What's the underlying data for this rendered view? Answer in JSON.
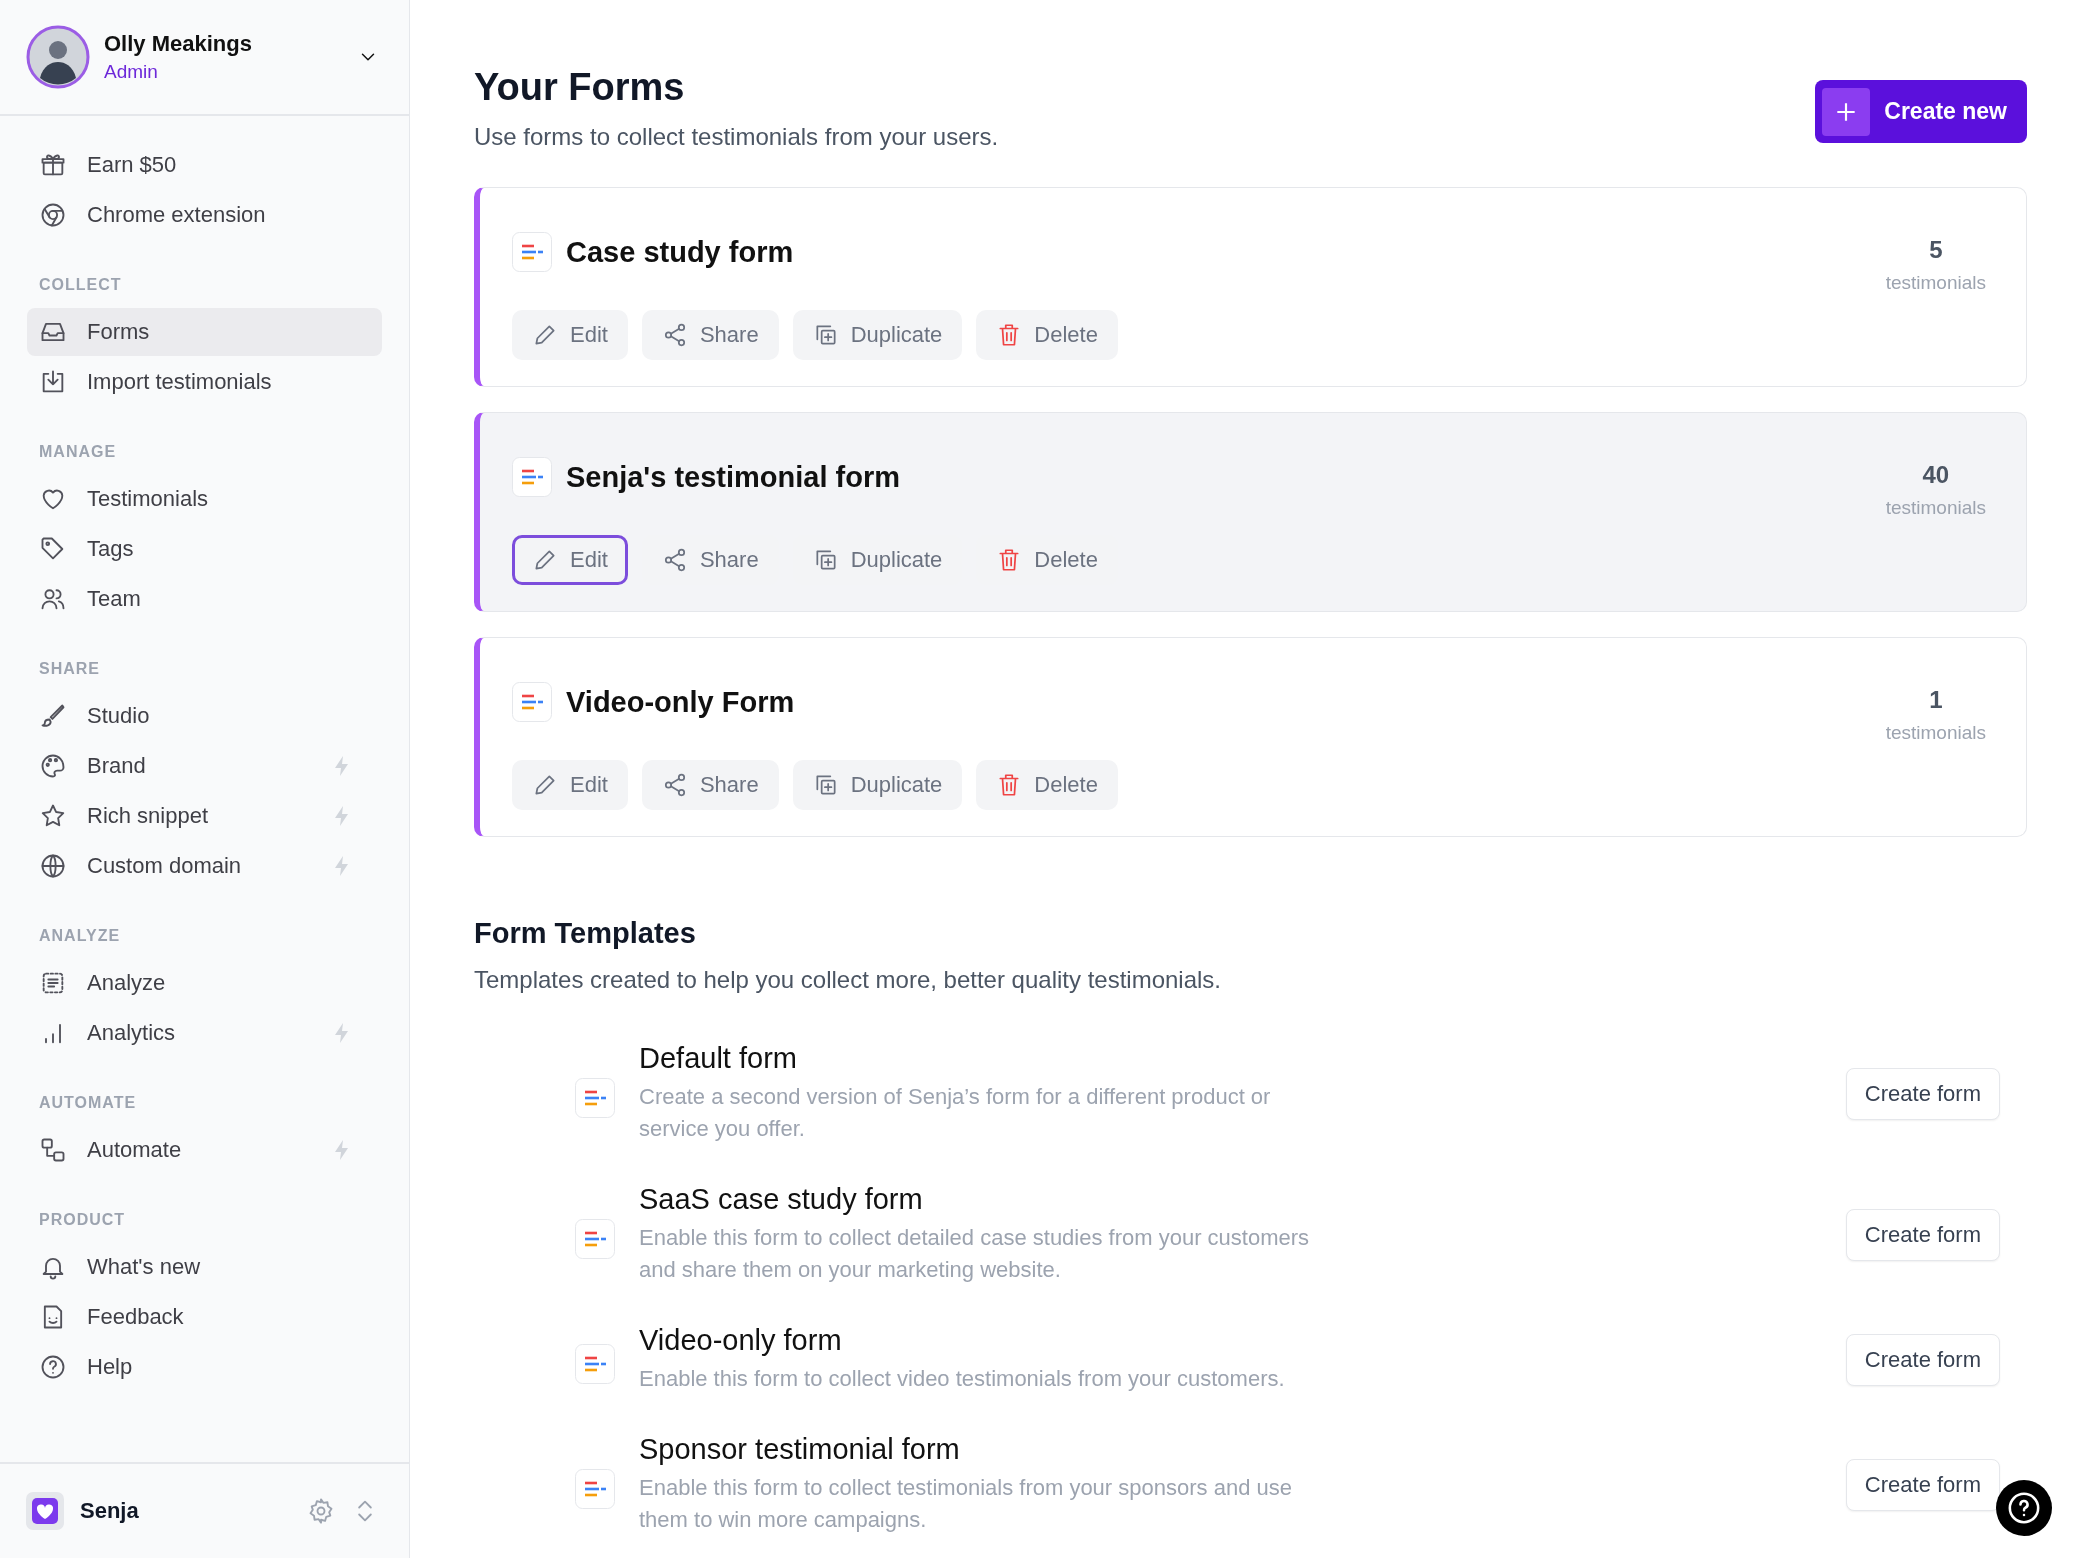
{
  "user": {
    "name": "Olly Meakings",
    "role": "Admin"
  },
  "sidebar": {
    "groups": [
      {
        "items": [
          {
            "label": "Earn $50",
            "selected": false,
            "pro": false
          },
          {
            "label": "Chrome extension",
            "selected": false,
            "pro": false
          }
        ]
      },
      {
        "heading": "COLLECT",
        "items": [
          {
            "label": "Forms",
            "selected": true,
            "pro": false
          },
          {
            "label": "Import testimonials",
            "selected": false,
            "pro": false
          }
        ]
      },
      {
        "heading": "MANAGE",
        "items": [
          {
            "label": "Testimonials",
            "selected": false,
            "pro": false
          },
          {
            "label": "Tags",
            "selected": false,
            "pro": false
          },
          {
            "label": "Team",
            "selected": false,
            "pro": false
          }
        ]
      },
      {
        "heading": "SHARE",
        "items": [
          {
            "label": "Studio",
            "selected": false,
            "pro": false
          },
          {
            "label": "Brand",
            "selected": false,
            "pro": true
          },
          {
            "label": "Rich snippet",
            "selected": false,
            "pro": true
          },
          {
            "label": "Custom domain",
            "selected": false,
            "pro": true
          }
        ]
      },
      {
        "heading": "ANALYZE",
        "items": [
          {
            "label": "Analyze",
            "selected": false,
            "pro": false
          },
          {
            "label": "Analytics",
            "selected": false,
            "pro": true
          }
        ]
      },
      {
        "heading": "AUTOMATE",
        "items": [
          {
            "label": "Automate",
            "selected": false,
            "pro": true
          }
        ]
      },
      {
        "heading": "PRODUCT",
        "items": [
          {
            "label": "What's new",
            "selected": false,
            "pro": false
          },
          {
            "label": "Feedback",
            "selected": false,
            "pro": false
          },
          {
            "label": "Help",
            "selected": false,
            "pro": false
          }
        ]
      }
    ]
  },
  "workspace": {
    "name": "Senja"
  },
  "page": {
    "title": "Your Forms",
    "subtitle": "Use forms to collect testimonials from your users.",
    "create_button": "Create new"
  },
  "forms": [
    {
      "title": "Case study form",
      "count": "5",
      "count_label": "testimonials",
      "highlighted": false,
      "actions": [
        {
          "kind": "edit",
          "label": "Edit",
          "focused": false
        },
        {
          "kind": "share",
          "label": "Share",
          "focused": false
        },
        {
          "kind": "duplicate",
          "label": "Duplicate",
          "focused": false
        },
        {
          "kind": "delete",
          "label": "Delete",
          "focused": false
        }
      ]
    },
    {
      "title": "Senja's testimonial form",
      "count": "40",
      "count_label": "testimonials",
      "highlighted": true,
      "actions": [
        {
          "kind": "edit",
          "label": "Edit",
          "focused": true
        },
        {
          "kind": "share",
          "label": "Share",
          "focused": false
        },
        {
          "kind": "duplicate",
          "label": "Duplicate",
          "focused": false
        },
        {
          "kind": "delete",
          "label": "Delete",
          "focused": false
        }
      ]
    },
    {
      "title": "Video-only Form",
      "count": "1",
      "count_label": "testimonials",
      "highlighted": false,
      "actions": [
        {
          "kind": "edit",
          "label": "Edit",
          "focused": false
        },
        {
          "kind": "share",
          "label": "Share",
          "focused": false
        },
        {
          "kind": "duplicate",
          "label": "Duplicate",
          "focused": false
        },
        {
          "kind": "delete",
          "label": "Delete",
          "focused": false
        }
      ]
    }
  ],
  "templates": {
    "title": "Form Templates",
    "subtitle": "Templates created to help you collect more, better quality testimonials.",
    "items": [
      {
        "title": "Default form",
        "description": "Create a second version of Senja’s form for a different product or service you offer.",
        "button": "Create form"
      },
      {
        "title": "SaaS case study form",
        "description": "Enable this form to collect detailed case studies from your customers and share them on your marketing website.",
        "button": "Create form"
      },
      {
        "title": "Video-only form",
        "description": "Enable this form to collect video testimonials from your customers.",
        "button": "Create form"
      },
      {
        "title": "Sponsor testimonial form",
        "description": "Enable this form to collect testimonials from your sponsors and use them to win more campaigns.",
        "button": "Create form"
      }
    ]
  }
}
